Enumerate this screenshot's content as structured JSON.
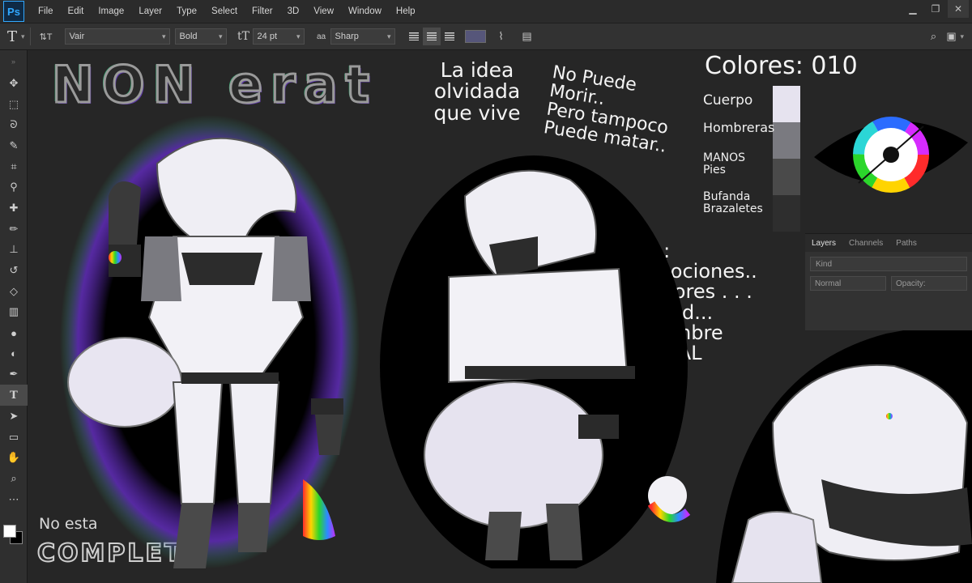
{
  "app": {
    "logo": "Ps"
  },
  "menu": [
    "File",
    "Edit",
    "Image",
    "Layer",
    "Type",
    "Select",
    "Filter",
    "3D",
    "View",
    "Window",
    "Help"
  ],
  "window_controls": {
    "minimize": "▁",
    "restore": "❐",
    "close": "✕"
  },
  "options_bar": {
    "tool_glyph": "T",
    "orient_glyph": "⇅T",
    "font_family": "Vair",
    "font_style": "Bold",
    "font_size": "24 pt",
    "aa_label": "aa",
    "anti_alias": "Sharp",
    "text_color": "#56567a"
  },
  "tools": [
    "move-icon",
    "marquee-icon",
    "lasso-icon",
    "quick-select-icon",
    "crop-icon",
    "eyedropper-icon",
    "healing-icon",
    "brush-icon",
    "clone-stamp-icon",
    "history-brush-icon",
    "eraser-icon",
    "gradient-icon",
    "blur-icon",
    "dodge-icon",
    "pen-icon",
    "type-icon",
    "path-select-icon",
    "shape-icon",
    "hand-icon",
    "zoom-icon",
    "more-icon"
  ],
  "canvas": {
    "title": "NON erat",
    "idea_text": "La idea\nolvidada\nque vive",
    "nopuede_text": "No Puede\nMorir..\nPero tampoco\nPuede matar..",
    "sin_text": "Sin:\n emociones..\n  colores . . .\n  edad...\n  Nombre\n   REAL",
    "noesta_text": "No esta",
    "completo_text": "COMPLETO",
    "colores_title": "Colores: 010",
    "color_legend": [
      {
        "label": "Cuerpo",
        "color": "#e6e3ef"
      },
      {
        "label": "Hombreras",
        "color": "#7a7a80"
      },
      {
        "label": "MANOS\nPies",
        "color": "#4a4a4a"
      },
      {
        "label": "Bufanda\nBrazaletes",
        "color": "#2e2e2e"
      }
    ]
  },
  "layers_panel": {
    "tabs": [
      "Layers",
      "Channels",
      "Paths"
    ],
    "kind_placeholder": "Kind",
    "blend_mode": "Normal",
    "opacity_label": "Opacity:"
  }
}
